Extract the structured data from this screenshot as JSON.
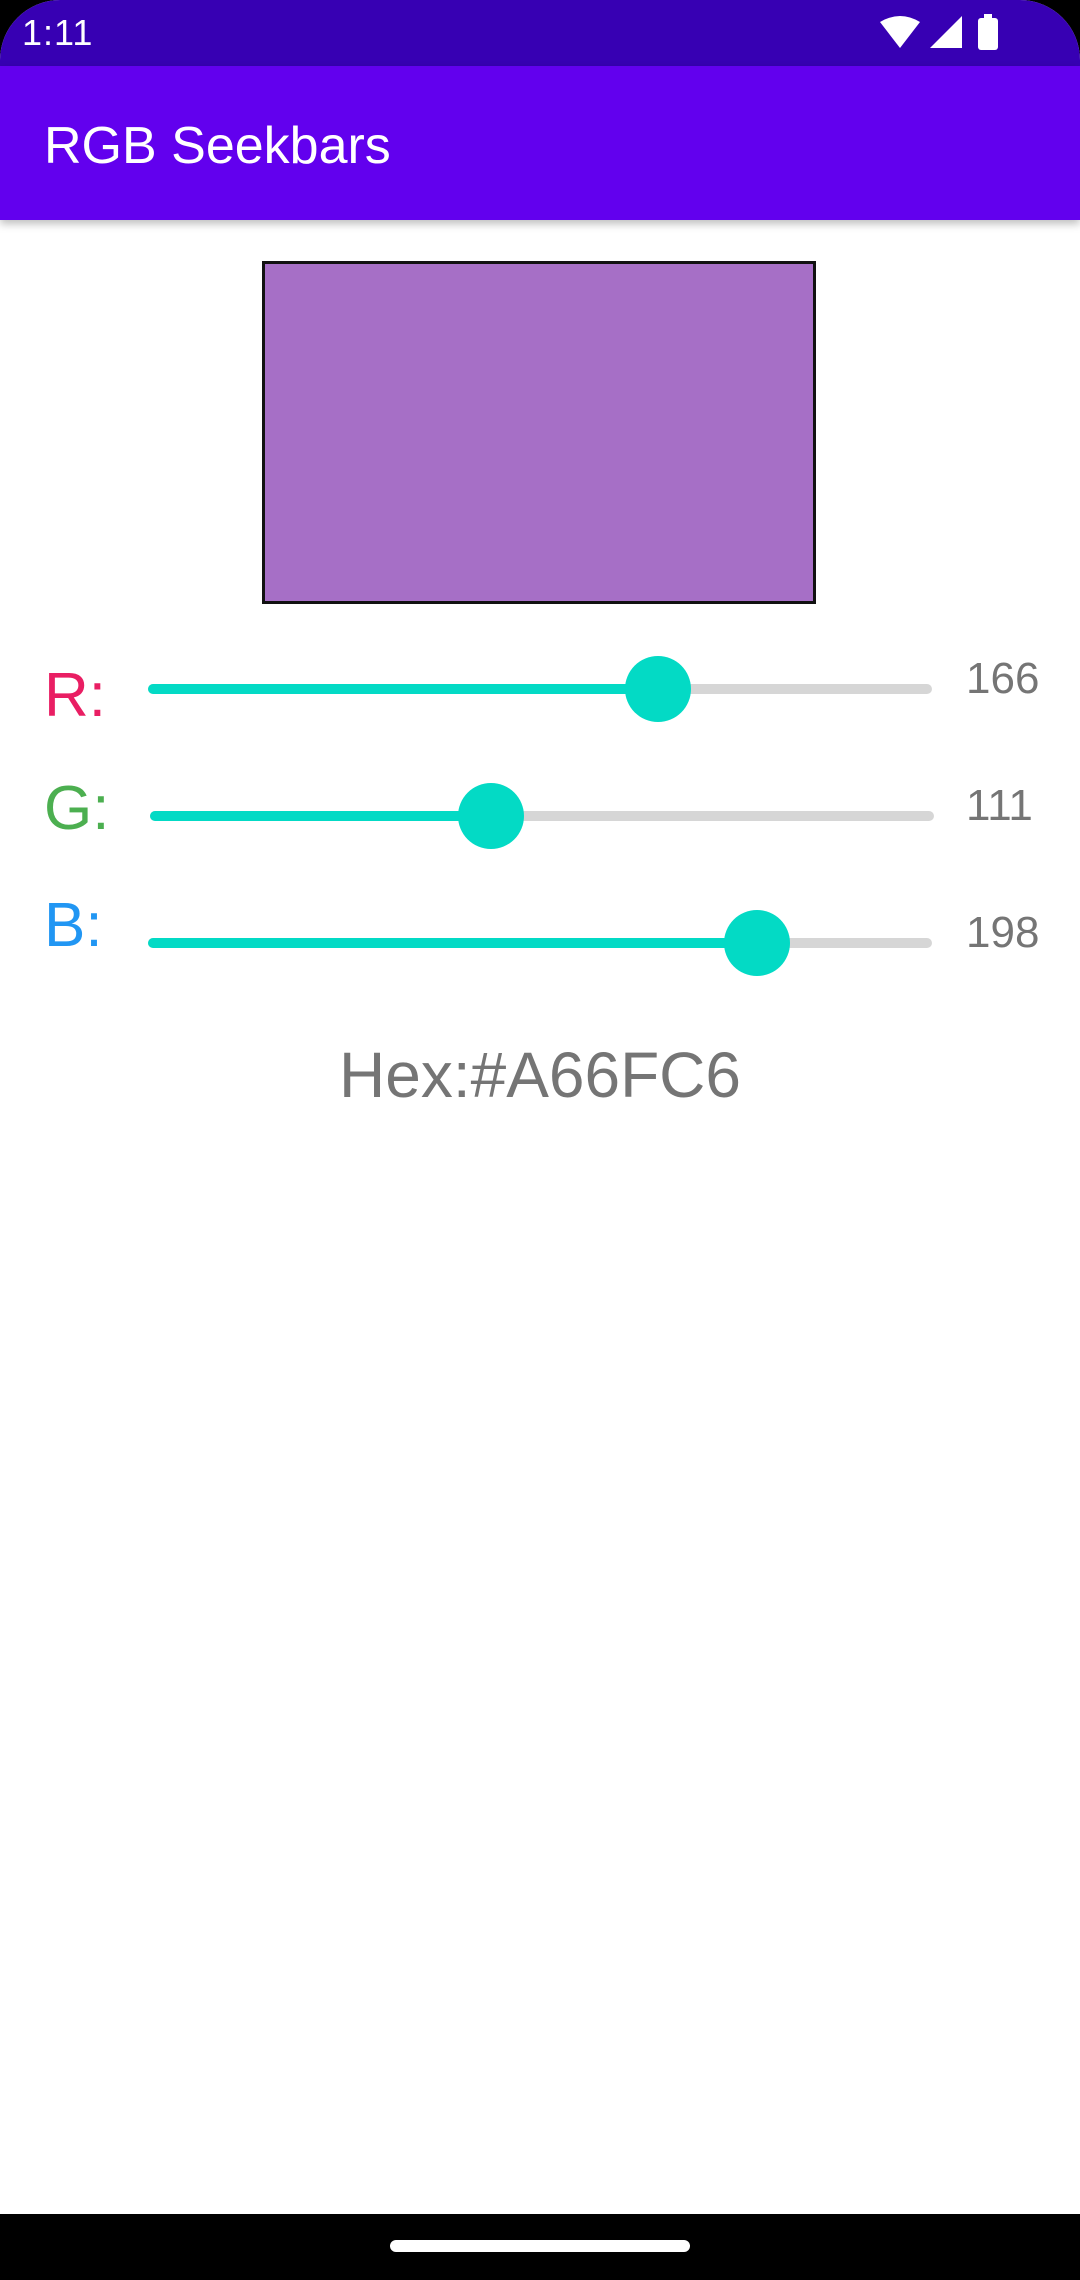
{
  "status_bar": {
    "time": "1:11",
    "icons": [
      "wifi-icon",
      "cellular-signal-icon",
      "battery-icon"
    ]
  },
  "app_bar": {
    "title": "RGB Seekbars",
    "color": "#6200ee"
  },
  "swatch": {
    "color": "#A66FC6"
  },
  "sliders": [
    {
      "label": "R:",
      "label_color": "#e91e63",
      "value": 166,
      "max": 255,
      "value_text": "166"
    },
    {
      "label": "G:",
      "label_color": "#4caf50",
      "value": 111,
      "max": 255,
      "value_text": "111"
    },
    {
      "label": "B:",
      "label_color": "#2196f3",
      "value": 198,
      "max": 255,
      "value_text": "198"
    }
  ],
  "accent_color": "#03dac5",
  "hex_display": "Hex:#A66FC6"
}
